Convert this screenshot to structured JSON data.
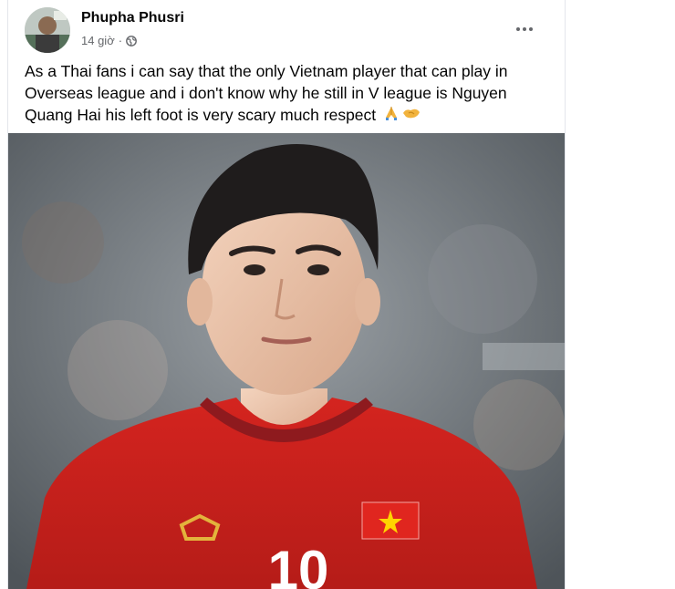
{
  "post": {
    "author": "Phupha Phusri",
    "timestamp": "14 giờ",
    "separator": "·",
    "privacy_icon": "globe-icon",
    "more_icon": "more-horizontal-icon",
    "text": "As a Thai fans i can say that the only Vietnam player that can play in Overseas league and i don't know why he still in V league is Nguyen Quang Hai his left foot is very scary much respect",
    "emojis": [
      "folded-hands-icon",
      "handshake-icon"
    ]
  },
  "photo": {
    "jersey_number": "10",
    "colors": {
      "jersey": "#d4241f",
      "collar": "#8e1a1e",
      "flag_red": "#e0261f",
      "flag_star": "#ffd400",
      "badge_gold": "#e3b33c"
    }
  }
}
